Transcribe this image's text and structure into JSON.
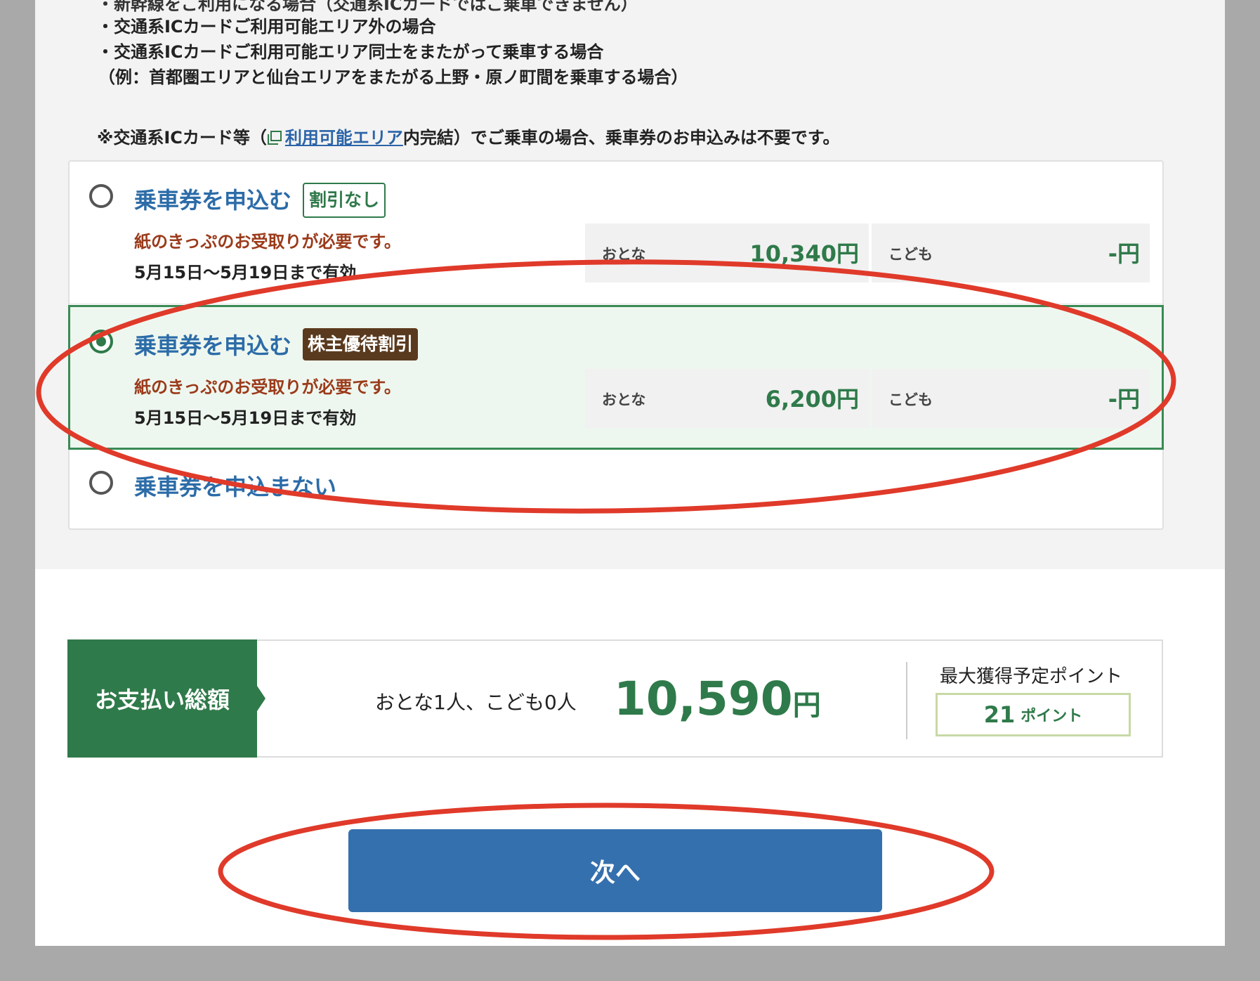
{
  "notices": {
    "line0": "・新幹線をご利用になる場合（交通系ICカードではご乗車できません）",
    "line1": "・交通系ICカードご利用可能エリア外の場合",
    "line2": "・交通系ICカードご利用可能エリア同士をまたがって乗車する場合",
    "line3": "（例：首都圏エリアと仙台エリアをまたがる上野・原ノ町間を乗車する場合）"
  },
  "ic_note": {
    "prefix": "※交通系ICカード等（",
    "link": "利用可能エリア",
    "suffix": "内完結）でご乗車の場合、乗車券のお申込みは不要です。"
  },
  "options": [
    {
      "title": "乗車券を申込む",
      "tag": "割引なし",
      "requirement": "紙のきっぷのお受取りが必要です。",
      "validity": "5月15日〜5月19日まで有効",
      "adult_label": "おとな",
      "adult_price": "10,340円",
      "child_label": "こども",
      "child_price": "-円",
      "selected": false
    },
    {
      "title": "乗車券を申込む",
      "tag": "株主優待割引",
      "requirement": "紙のきっぷのお受取りが必要です。",
      "validity": "5月15日〜5月19日まで有効",
      "adult_label": "おとな",
      "adult_price": "6,200円",
      "child_label": "こども",
      "child_price": "-円",
      "selected": true
    },
    {
      "title": "乗車券を申込まない",
      "selected": false
    }
  ],
  "summary": {
    "label": "お支払い総額",
    "people": "おとな1人、こども0人",
    "total": "10,590",
    "yen": "円",
    "points_label": "最大獲得予定ポイント",
    "points_value": "21",
    "points_unit": "ポイント"
  },
  "next_button": "次へ",
  "colors": {
    "accent_green": "#2f7a4a",
    "link_blue": "#2c6ca8",
    "button_blue": "#3570ae",
    "annotation_red": "#e03a2a"
  }
}
